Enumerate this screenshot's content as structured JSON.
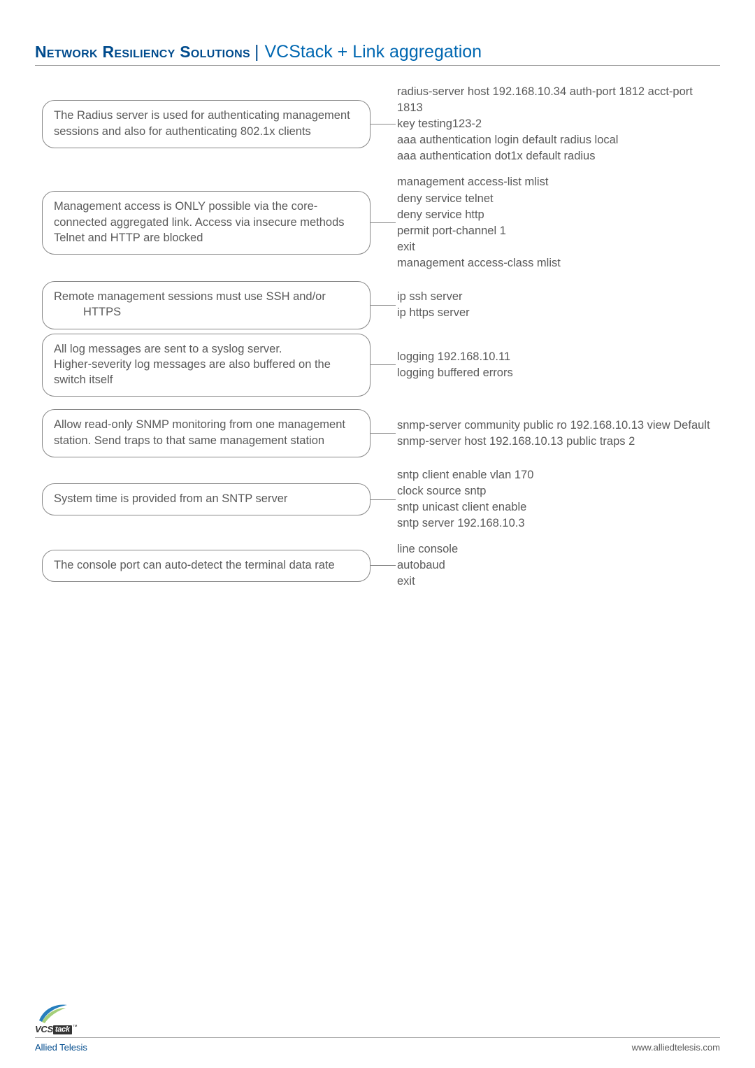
{
  "header": {
    "left": "Network Resiliency Solutions",
    "separator": "|",
    "right": "VCStack + Link aggregation"
  },
  "sections": [
    {
      "desc": "The Radius server is used for authenticating management sessions and also for authenticating 802.1x clients",
      "config": "radius-server host 192.168.10.34 auth-port 1812 acct-port 1813\nkey testing123-2\naaa authentication login default radius local\naaa authentication dot1x default radius"
    },
    {
      "desc": "Management access is ONLY possible via the core-connected aggregated link. Access via insecure methods Telnet and HTTP are blocked",
      "config": "management access-list mlist\ndeny service telnet\ndeny service http\npermit port-channel 1\nexit\nmanagement access-class mlist"
    },
    {
      "desc": "Remote management sessions must use SSH and/or",
      "desc_extra": "HTTPS",
      "config": "ip ssh server\nip https server"
    },
    {
      "desc": "All log messages are sent to a syslog server.\nHigher-severity log messages are also buffered on the switch itself",
      "config": "logging 192.168.10.11\nlogging buffered errors"
    },
    {
      "desc": "Allow read-only SNMP monitoring from one management station. Send traps to that same management station",
      "config": "snmp-server community public ro 192.168.10.13 view Default\nsnmp-server host 192.168.10.13 public traps 2"
    },
    {
      "desc": "System time is provided from an SNTP server",
      "config": "sntp client enable vlan 170\nclock source sntp\nsntp unicast client enable\nsntp server 192.168.10.3"
    },
    {
      "desc": "The console port can auto-detect the terminal data rate",
      "config": "line console\nautobaud\nexit"
    }
  ],
  "logo": {
    "text_vc": "VCS",
    "text_tack": "tack",
    "tm": "™"
  },
  "footer": {
    "left": "Allied Telesis",
    "right": "www.alliedtelesis.com"
  }
}
